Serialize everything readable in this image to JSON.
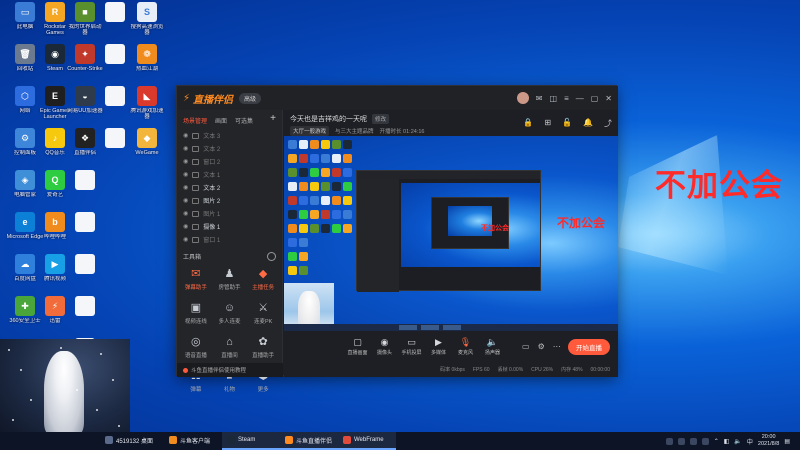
{
  "desktop": {
    "icons": [
      {
        "label": "此电脑",
        "color": "#3a7bd5",
        "glyph": "▭"
      },
      {
        "label": "Rockstar Games Launcher",
        "color": "#f5a623",
        "glyph": "R"
      },
      {
        "label": "我的世界启动器",
        "color": "#5a8f2e",
        "glyph": "■"
      },
      {
        "label": "",
        "color": "#f4f6fa",
        "glyph": ""
      },
      {
        "label": "搜狗高速浏览器",
        "color": "#e8eef8",
        "glyph": "S"
      },
      {
        "label": "回收站",
        "color": "#6b7a8f",
        "glyph": "🗑"
      },
      {
        "label": "Steam",
        "color": "#1b2838",
        "glyph": "◉"
      },
      {
        "label": "Counter-Strike",
        "color": "#c0392b",
        "glyph": "✦"
      },
      {
        "label": "",
        "color": "#f4f6fa",
        "glyph": ""
      },
      {
        "label": "热血江湖",
        "color": "#f08c1e",
        "glyph": "❁"
      },
      {
        "label": "网络",
        "color": "#2d6cdf",
        "glyph": "⬡"
      },
      {
        "label": "Epic Games Launcher",
        "color": "#1f1f1f",
        "glyph": "E"
      },
      {
        "label": "网易UU加速器",
        "color": "#2f3b4a",
        "glyph": "◒"
      },
      {
        "label": "",
        "color": "#f4f6fa",
        "glyph": ""
      },
      {
        "label": "腾讯游戏加速器",
        "color": "#d93a2b",
        "glyph": "◣"
      },
      {
        "label": "控制面板",
        "color": "#3d86d9",
        "glyph": "⚙"
      },
      {
        "label": "QQ音乐",
        "color": "#f6c90e",
        "glyph": "♪"
      },
      {
        "label": "直播伴侣",
        "color": "#222",
        "glyph": "❖"
      },
      {
        "label": "",
        "color": "#f4f6fa",
        "glyph": ""
      },
      {
        "label": "WeGame",
        "color": "#f2b63c",
        "glyph": "◆"
      },
      {
        "label": "电脑管家",
        "color": "#3f8fd8",
        "glyph": "◈"
      },
      {
        "label": "爱奇艺",
        "color": "#2ecc40",
        "glyph": "Q"
      },
      {
        "label": "",
        "color": "#f4f6fa",
        "glyph": ""
      },
      {
        "label": "Microsoft Edge",
        "color": "#0c7fd6",
        "glyph": "e"
      },
      {
        "label": "哔哩哔哩",
        "color": "#f08c1e",
        "glyph": "b"
      },
      {
        "label": "",
        "color": "#f4f6fa",
        "glyph": ""
      },
      {
        "label": "百度网盘",
        "color": "#2f7fdc",
        "glyph": "☁"
      },
      {
        "label": "腾讯视频",
        "color": "#18a0e6",
        "glyph": "▶"
      },
      {
        "label": "",
        "color": "#f4f6fa",
        "glyph": ""
      },
      {
        "label": "360安全卫士",
        "color": "#4aa53b",
        "glyph": "✚"
      },
      {
        "label": "迅雷",
        "color": "#f26b3a",
        "glyph": "⚡"
      },
      {
        "label": "",
        "color": "#f4f6fa",
        "glyph": ""
      },
      {
        "label": "",
        "color": "#f4f6fa",
        "glyph": ""
      },
      {
        "label": "",
        "color": "#f4f6fa",
        "glyph": ""
      }
    ]
  },
  "overlay_text": "不加公会",
  "app": {
    "logo": "直播伴侣",
    "edition": "高级",
    "left_tabs": [
      "场景管理",
      "画面",
      "可选集"
    ],
    "add": "+",
    "sources": [
      {
        "name": "文本 3",
        "bright": false
      },
      {
        "name": "文本 2",
        "bright": false
      },
      {
        "name": "窗口 2",
        "bright": false
      },
      {
        "name": "文本 1",
        "bright": false
      },
      {
        "name": "文本 2",
        "bright": true
      },
      {
        "name": "图片 2",
        "bright": true
      },
      {
        "name": "图片 1",
        "bright": false
      },
      {
        "name": "摄像 1",
        "bright": true
      },
      {
        "name": "窗口 1",
        "bright": false
      }
    ],
    "tools_label": "工具箱",
    "tools": [
      {
        "label": "弹幕助手",
        "icon": "✉",
        "hot": true
      },
      {
        "label": "房管助手",
        "icon": "♟",
        "hot": false
      },
      {
        "label": "主播任务",
        "icon": "◆",
        "hot": true
      },
      {
        "label": "视频连线",
        "icon": "▣",
        "hot": false
      },
      {
        "label": "多人连麦",
        "icon": "☺",
        "hot": false
      },
      {
        "label": "连麦PK",
        "icon": "⚔",
        "hot": false
      },
      {
        "label": "语音直播",
        "icon": "◎",
        "hot": false
      },
      {
        "label": "直播间",
        "icon": "⌂",
        "hot": false
      },
      {
        "label": "直播助手",
        "icon": "✿",
        "hot": false
      },
      {
        "label": "弹幕",
        "icon": "☷",
        "hot": false
      },
      {
        "label": "礼物",
        "icon": "♛",
        "hot": false
      },
      {
        "label": "更多",
        "icon": "⬢",
        "hot": false
      }
    ],
    "footer": "斗鱼直播伴侣使用教程",
    "stream_title": "今天也是吉祥鸡的一天呢",
    "edit_label": "修改",
    "category": "大厅一般游戏",
    "meta": [
      "与三大主题品牌",
      "开播时长 01:24:16"
    ],
    "bottom_tools": [
      {
        "label": "直播画面",
        "icon": "▢"
      },
      {
        "label": "摄像头",
        "icon": "◉"
      },
      {
        "label": "手机投屏",
        "icon": "▭"
      },
      {
        "label": "多媒体",
        "icon": "▶"
      },
      {
        "label": "麦克风",
        "icon": "🎙"
      },
      {
        "label": "扬声器",
        "icon": "🔈"
      }
    ],
    "go_live": "开始直播",
    "status": [
      "码率 0kbps",
      "FPS 60",
      "丢帧 0.00%",
      "CPU 26%",
      "内存 48%",
      "00:00:00"
    ]
  },
  "taskbar": {
    "items": [
      {
        "label": "4519132 桌面",
        "color": "#5a6a8a",
        "open": false
      },
      {
        "label": "斗鱼客户端",
        "color": "#f08c1e",
        "open": false
      },
      {
        "label": "Steam",
        "color": "#1b2838",
        "open": true
      },
      {
        "label": "斗鱼直播伴侣",
        "color": "#ff8a1f",
        "open": true
      },
      {
        "label": "WebFrame",
        "color": "#e14b3b",
        "open": true
      }
    ],
    "lang": "中",
    "time": "20:00",
    "date": "2021/8/8"
  }
}
